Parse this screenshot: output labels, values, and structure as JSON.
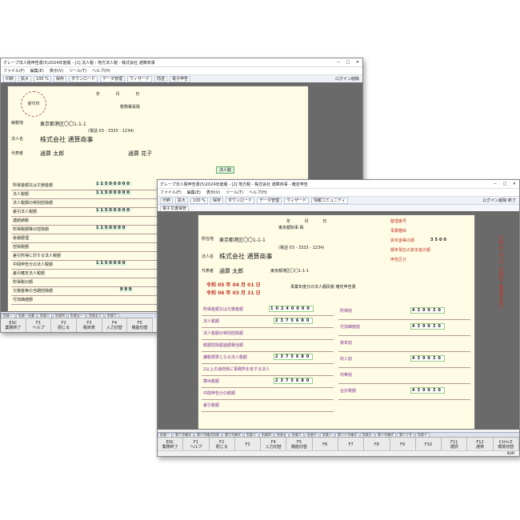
{
  "back": {
    "title": "グレープ法人税申告書(5)2024年度版 - [1] 法人税・地方法人税 - 株式会社 通算商事",
    "menu": [
      "ファイル(F)",
      "編集(E)",
      "表示(V)",
      "ツール(T)",
      "ヘルプ(H)"
    ],
    "toolbar": [
      "印刷",
      "拡大",
      "100 %",
      "保存",
      "ダウンロード",
      "データ管理",
      "ウィザード",
      "前送",
      "電子申告"
    ],
    "right_label": "ログイン削除",
    "form": {
      "receipt": "受付印",
      "office": "税務署長殿",
      "year_labels": [
        "年",
        "月",
        "日"
      ],
      "address_label": "納税地",
      "address": "東京都港区〇〇1-1-1",
      "phone": "(電話 03 - 3333 - 1234)",
      "name_label": "法人名",
      "company": "株式会社 通算商事",
      "rep_label": "代表者",
      "rep": "通算 太郎",
      "acct": "通算 花子",
      "tax_type": "法人税",
      "rows": [
        "所得金額又は欠損金額",
        "法人税額",
        "法人税額の特別控除額",
        "差引法人税額",
        "連結納税",
        "所得税額等の控除額",
        "仮装経理",
        "控除税額",
        "差引所得に対する法人税額",
        "中間申告分の法人税額",
        "差引確定法人税額",
        "所得税の額",
        "欠損金等の当期控除額",
        "付加価値額"
      ],
      "values": [
        "11500000",
        "11500000",
        "11500000",
        "1150000",
        "1150000",
        "999"
      ]
    },
    "fkeys": [
      [
        "ESC",
        "業務終了"
      ],
      [
        "F1",
        "ヘルプ"
      ],
      [
        "F2",
        "閉じる"
      ],
      [
        "F3",
        "税目表"
      ],
      [
        "F4",
        "入力切替"
      ],
      [
        "F5",
        "機能切替"
      ]
    ],
    "tabs": [
      "別表一",
      "別表一次葉",
      "別表二",
      "別表四",
      "別表五一",
      "別表五二",
      "別表六"
    ]
  },
  "front": {
    "title": "グレープ法人税申告書(5)2024年度版 - [2] 地方税 - 株式会社 通算商事 - 確定申告",
    "menu": [
      "ファイル(F)",
      "編集(E)",
      "表示(V)",
      "ツール(T)",
      "ヘルプ(H)"
    ],
    "toolbar": [
      "印刷",
      "拡大",
      "100 %",
      "保存",
      "ダウンロード",
      "データ管理",
      "ウィザード",
      "情報コミュニティ"
    ],
    "toolbar2": [
      "電子文書保管"
    ],
    "right_label": "ログイン削除 終了",
    "form": {
      "office": "東京都知事 殿",
      "year_labels": [
        "年",
        "月",
        "日"
      ],
      "address_label": "所在地",
      "address": "東京都港区〇〇1-1-1",
      "phone": "(電話 03 - 3333 - 1234)",
      "name_label": "法人名",
      "company": "株式会社 通算商事",
      "rep_label": "代表者",
      "rep": "通算 太郎",
      "rep_addr": "東京都港区〇〇1-1-1",
      "period_from": "令和 05 年 04 月 01 日",
      "period_to": "令和 06 年 03 月 31 日",
      "period_label": "事業年度分の法人都民税 確定申告書",
      "right_labels": [
        "整理番号",
        "事業種目",
        "資本金等の額",
        "期末現在の資本金の額",
        "申告区分"
      ],
      "right_values": [
        "3500"
      ],
      "left_rows": [
        "所得金額又は欠損金額",
        "法人税額",
        "法人税額の特別控除額",
        "税額控除超過額相当額",
        "課税標準となる法人税額",
        "2以上の道府県に事務所を有する法人",
        "算出税額",
        "中間申告分の税額",
        "差引税額"
      ],
      "left_values": [
        "10240000",
        "2375680",
        "2375680",
        "2375680"
      ],
      "right_rows": [
        "所得割",
        "付加価値割",
        "資本割",
        "収入割",
        "均等割",
        "合計税額"
      ],
      "right_amounts": [
        "439030",
        "439030",
        "439030",
        "439030"
      ],
      "side_text": "令和 年 月 日 以後終了事業年度分"
    },
    "fkeys": [
      [
        "ESC",
        "業務終了"
      ],
      [
        "F1",
        "ヘルプ"
      ],
      [
        "F2",
        "閉じる"
      ],
      [
        "F3",
        ""
      ],
      [
        "F4",
        "入力切替"
      ],
      [
        "F5",
        "機能切替"
      ],
      [
        "F6",
        ""
      ],
      [
        "F7",
        ""
      ],
      [
        "F8",
        ""
      ],
      [
        "F9",
        ""
      ],
      [
        "F10",
        ""
      ],
      [
        "F11",
        "選択"
      ],
      [
        "F12",
        "通常"
      ],
      [
        "Ctrl+Z",
        "環境切替"
      ]
    ],
    "tabs": [
      "別表一",
      "第六号様式",
      "第六号様式別表",
      "第七号様式",
      "別表二",
      "別表四",
      "別表五",
      "別表六",
      "別表七",
      "別表八",
      "第二十号様式",
      "別表九",
      "第十号様式",
      "第二十号",
      "別表十"
    ],
    "status": "NUM"
  }
}
